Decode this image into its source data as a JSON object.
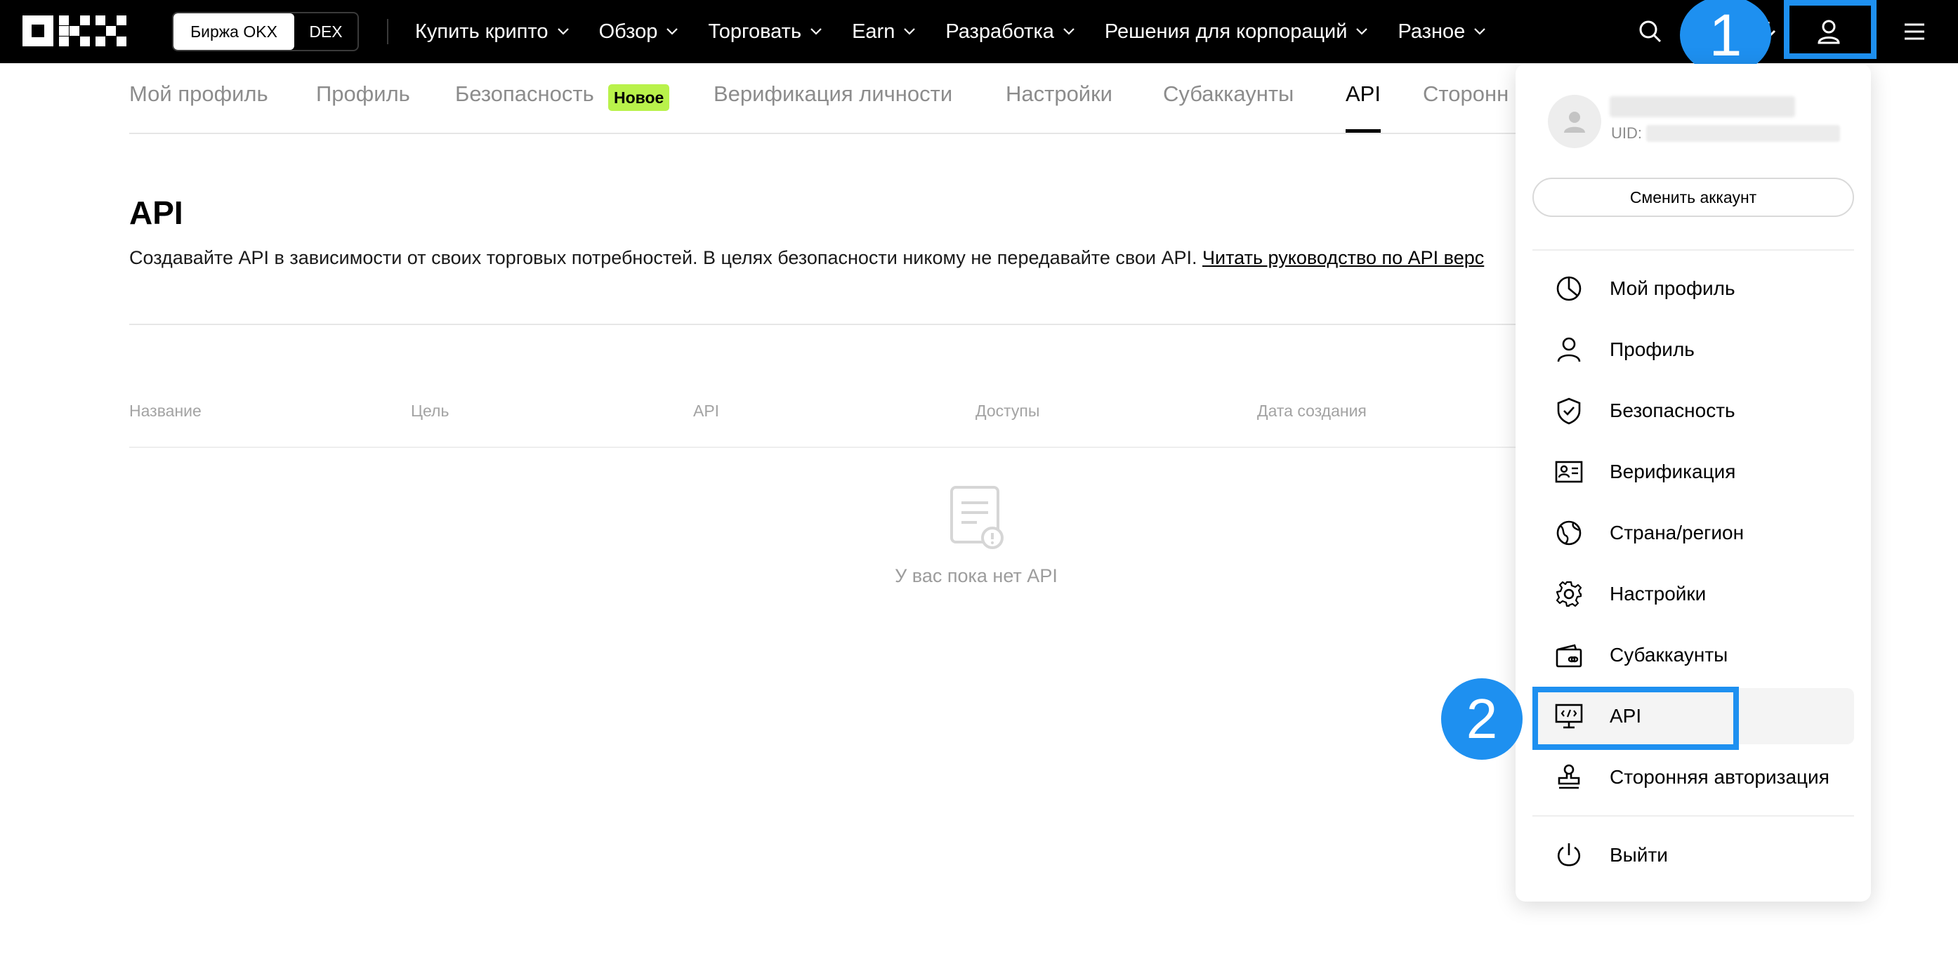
{
  "navbar": {
    "logo_text": "OKX",
    "exchange_toggle": {
      "active": "Биржа OKX",
      "inactive": "DEX"
    },
    "menu": [
      {
        "label": "Купить крипто"
      },
      {
        "label": "Обзор"
      },
      {
        "label": "Торговать"
      },
      {
        "label": "Earn"
      },
      {
        "label": "Разработка"
      },
      {
        "label": "Решения для корпораций"
      },
      {
        "label": "Разное"
      }
    ],
    "icons": [
      "search-icon",
      "download-icon",
      "user-icon",
      "hamburger-menu-icon"
    ]
  },
  "annotations": {
    "step1": "1",
    "step2": "2",
    "color": "#1e90f0"
  },
  "tabs": [
    {
      "label": "Мой профиль"
    },
    {
      "label": "Профиль"
    },
    {
      "label": "Безопасность",
      "badge": "Новое"
    },
    {
      "label": "Верификация личности"
    },
    {
      "label": "Настройки"
    },
    {
      "label": "Субаккаунты"
    },
    {
      "label": "API",
      "active": true
    },
    {
      "label": "Сторонн"
    }
  ],
  "main": {
    "title": "API",
    "description": "Создавайте API в зависимости от своих торговых потребностей. В целях безопасности никому не передавайте свои API. ",
    "guide_link": "Читать руководство по API верс",
    "table_headers": [
      "Название",
      "Цель",
      "API",
      "Доступы",
      "Дата создания"
    ],
    "empty_text": "У вас пока нет API"
  },
  "dropdown": {
    "uid_label": "UID:",
    "switch_account": "Сменить аккаунт",
    "items": [
      {
        "label": "Мой профиль",
        "icon": "pie-chart-icon"
      },
      {
        "label": "Профиль",
        "icon": "user-icon"
      },
      {
        "label": "Безопасность",
        "icon": "shield-check-icon"
      },
      {
        "label": "Верификация",
        "icon": "id-card-icon"
      },
      {
        "label": "Страна/регион",
        "icon": "globe-icon"
      },
      {
        "label": "Настройки",
        "icon": "gear-icon"
      },
      {
        "label": "Субаккаунты",
        "icon": "wallet-link-icon"
      },
      {
        "label": "API",
        "icon": "code-monitor-icon",
        "highlighted": true
      },
      {
        "label": "Сторонняя авторизация",
        "icon": "stamp-icon"
      }
    ],
    "logout": {
      "label": "Выйти",
      "icon": "power-icon"
    }
  },
  "colors": {
    "badge_new": "#b9f24b",
    "navbar": "#000000",
    "highlight": "#1e90f0"
  }
}
